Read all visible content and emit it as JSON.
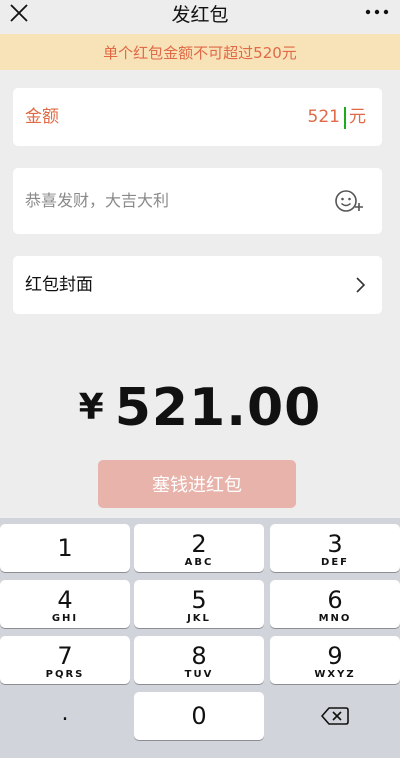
{
  "nav": {
    "title": "发红包",
    "close_icon": "close-icon",
    "more_icon": "more-icon"
  },
  "warning": "单个红包金额不可超过520元",
  "amount": {
    "label": "金额",
    "value": "521",
    "unit": "元"
  },
  "greeting": {
    "placeholder": "恭喜发财，大吉大利",
    "icon": "emoji-add-icon"
  },
  "cover": {
    "label": "红包封面",
    "icon": "chevron-right-icon"
  },
  "total": {
    "currency": "¥",
    "value": "521.00"
  },
  "submit_label": "塞钱进红包",
  "keyboard": {
    "keys": [
      {
        "digit": "1",
        "letters": ""
      },
      {
        "digit": "2",
        "letters": "ABC"
      },
      {
        "digit": "3",
        "letters": "DEF"
      },
      {
        "digit": "4",
        "letters": "GHI"
      },
      {
        "digit": "5",
        "letters": "JKL"
      },
      {
        "digit": "6",
        "letters": "MNO"
      },
      {
        "digit": "7",
        "letters": "PQRS"
      },
      {
        "digit": "8",
        "letters": "TUV"
      },
      {
        "digit": "9",
        "letters": "WXYZ"
      },
      {
        "digit": ".",
        "letters": ""
      },
      {
        "digit": "0",
        "letters": ""
      }
    ],
    "backspace_icon": "backspace-icon"
  },
  "colors": {
    "accent": "#e06a46",
    "warning_bg": "#f8e2b8",
    "button_disabled": "#e8b3aa",
    "cursor": "#1aad19"
  }
}
